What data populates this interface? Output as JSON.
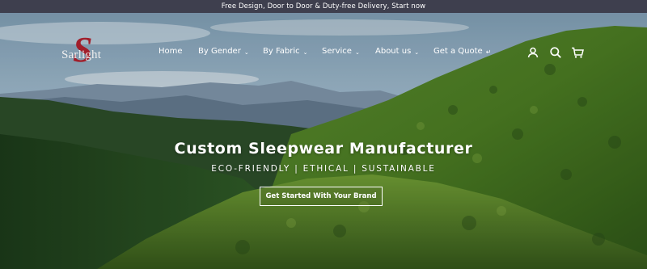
{
  "announcement": {
    "text": "Free Design, Door to Door & Duty-free Delivery, Start now"
  },
  "logo": {
    "mark": "S",
    "word": "Sarlight"
  },
  "nav": {
    "home": "Home",
    "by_gender": "By Gender",
    "by_fabric": "By Fabric",
    "service": "Service",
    "about_us": "About us",
    "get_a_quote": "Get a Quote"
  },
  "header_icons": [
    "user-icon",
    "search-icon",
    "cart-icon"
  ],
  "hero": {
    "title": "Custom Sleepwear Manufacturer",
    "subtitle": "ECO-FRIENDLY | ETHICAL | SUSTAINABLE",
    "cta": "Get Started With Your Brand"
  },
  "colors": {
    "announcement_bar": "#3e3f4e",
    "logo_mark": "#a11e2a",
    "forest": "#3f6a1f",
    "sky": "#9fbbd0"
  }
}
